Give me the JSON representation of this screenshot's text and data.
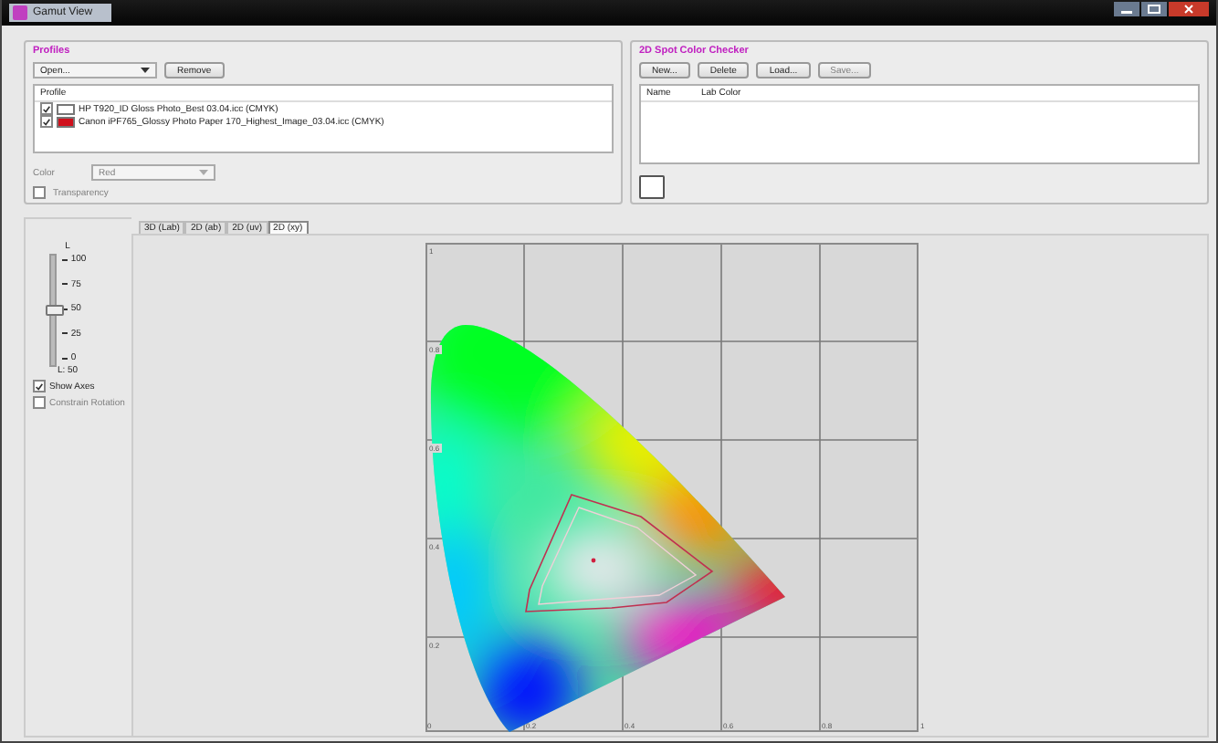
{
  "window": {
    "title": "Gamut View"
  },
  "profiles": {
    "title": "Profiles",
    "open_dropdown": "Open...",
    "remove_button": "Remove",
    "column": "Profile",
    "items": [
      {
        "name": "HP T920_ID Gloss Photo_Best 03.04.icc (CMYK)",
        "checked": true,
        "color": "#ffffff"
      },
      {
        "name": "Canon iPF765_Glossy Photo Paper 170_Highest_Image_03.04.icc (CMYK)",
        "checked": true,
        "color": "#d0101c"
      }
    ],
    "color_label": "Color",
    "color_value": "Red",
    "color_disabled": true,
    "transparency": {
      "label": "Transparency",
      "checked": false,
      "disabled": true
    }
  },
  "spot_checker": {
    "title": "2D Spot Color Checker",
    "buttons": [
      {
        "label": "New...",
        "disabled": false
      },
      {
        "label": "Delete",
        "disabled": false
      },
      {
        "label": "Load...",
        "disabled": false
      },
      {
        "label": "Save...",
        "disabled": true
      }
    ],
    "columns": [
      "Name",
      "Lab Color"
    ]
  },
  "l_slider": {
    "title": "L",
    "ticks": [
      "100",
      "75",
      "50",
      "25",
      "0"
    ],
    "level": 0.5,
    "reading": "L: 50"
  },
  "options": [
    {
      "label": "Show Axes",
      "checked": true,
      "disabled": false
    },
    {
      "label": "Constrain Rotation",
      "checked": false,
      "disabled": true
    }
  ],
  "tabs": [
    {
      "label": "3D (Lab)",
      "selected": false
    },
    {
      "label": "2D (ab)",
      "selected": false
    },
    {
      "label": "2D (uv)",
      "selected": false
    },
    {
      "label": "2D (xy)",
      "selected": true
    }
  ],
  "diagram": {
    "y_ticks": [
      "1",
      "0.8",
      "0.6",
      "0.4",
      "0.2"
    ],
    "x_ticks": [
      "0",
      "0.2",
      "0.4",
      "0.6",
      "0.8",
      "1"
    ]
  }
}
